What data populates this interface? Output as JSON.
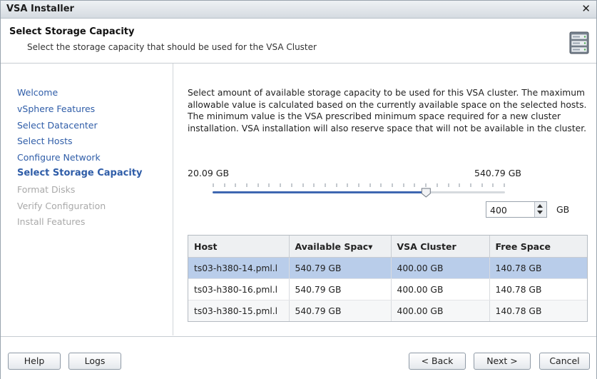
{
  "window": {
    "title": "VSA Installer",
    "close_glyph": "✕"
  },
  "header": {
    "title": "Select Storage Capacity",
    "subtitle": "Select the storage capacity that should be used for the VSA Cluster",
    "icon": "storage-server-icon"
  },
  "sidebar": {
    "items": [
      {
        "label": "Welcome",
        "state": "link"
      },
      {
        "label": "vSphere Features",
        "state": "link"
      },
      {
        "label": "Select Datacenter",
        "state": "link"
      },
      {
        "label": "Select Hosts",
        "state": "link"
      },
      {
        "label": "Configure Network",
        "state": "link"
      },
      {
        "label": "Select Storage Capacity",
        "state": "active"
      },
      {
        "label": "Format Disks",
        "state": "disabled"
      },
      {
        "label": "Verify Configuration",
        "state": "disabled"
      },
      {
        "label": "Install Features",
        "state": "disabled"
      }
    ]
  },
  "content": {
    "description": "Select amount of available storage capacity to be used for this VSA cluster. The maximum allowable value is calculated based on the currently available space on the selected hosts. The minimum value is the VSA prescribed minimum space required for a new cluster installation. VSA installation will also reserve space that will not be available in the cluster.",
    "slider": {
      "min_label": "20.09 GB",
      "max_label": "540.79 GB",
      "fraction": 0.73
    },
    "spinner": {
      "value": "400",
      "unit": "GB"
    },
    "table": {
      "columns": [
        "Host",
        "Available Spac▾",
        "VSA Cluster",
        "Free Space"
      ],
      "rows": [
        [
          "ts03-h380-14.pml.l",
          "540.79 GB",
          "400.00 GB",
          "140.78 GB"
        ],
        [
          "ts03-h380-16.pml.l",
          "540.79 GB",
          "400.00 GB",
          "140.78 GB"
        ],
        [
          "ts03-h380-15.pml.l",
          "540.79 GB",
          "400.00 GB",
          "140.78 GB"
        ]
      ],
      "selected_row": 0
    }
  },
  "footer": {
    "help": "Help",
    "logs": "Logs",
    "back": "< Back",
    "next": "Next >",
    "cancel": "Cancel"
  }
}
